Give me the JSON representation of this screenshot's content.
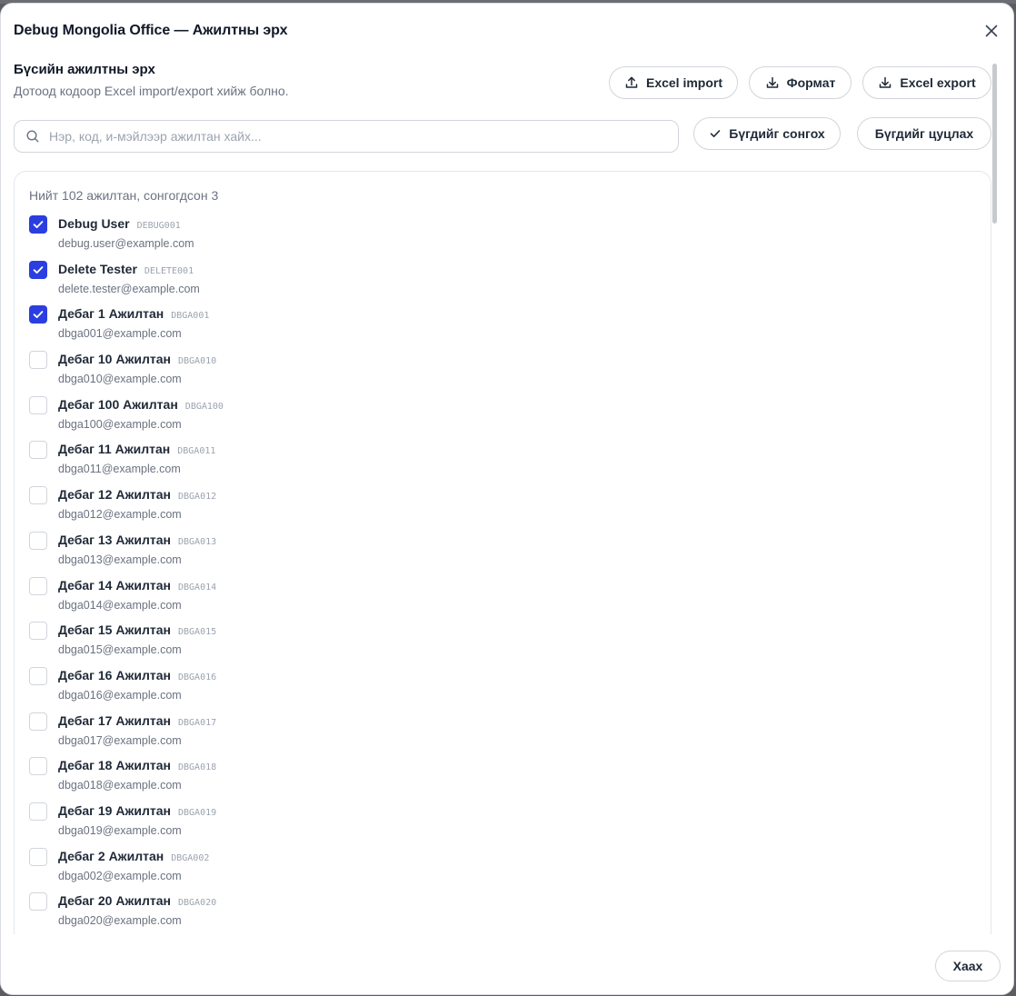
{
  "dialog": {
    "title": "Debug Mongolia Office — Ажилтны эрх"
  },
  "section": {
    "title": "Бүсийн ажилтны эрх",
    "subtitle": "Дотоод кодоор Excel import/export хийж болно."
  },
  "toolbar": {
    "import_label": "Excel import",
    "format_label": "Формат",
    "export_label": "Excel export",
    "select_all_label": "Бүгдийг сонгох",
    "clear_all_label": "Бүгдийг цуцлах"
  },
  "search": {
    "placeholder": "Нэр, код, и-мэйлээр ажилтан хайх...",
    "value": ""
  },
  "list": {
    "summary": "Нийт 102 ажилтан, сонгогдсон 3",
    "employees": [
      {
        "name": "Debug User",
        "code": "DEBUG001",
        "email": "debug.user@example.com",
        "checked": true
      },
      {
        "name": "Delete Tester",
        "code": "DELETE001",
        "email": "delete.tester@example.com",
        "checked": true
      },
      {
        "name": "Дебаг 1 Ажилтан",
        "code": "DBGA001",
        "email": "dbga001@example.com",
        "checked": true
      },
      {
        "name": "Дебаг 10 Ажилтан",
        "code": "DBGA010",
        "email": "dbga010@example.com",
        "checked": false
      },
      {
        "name": "Дебаг 100 Ажилтан",
        "code": "DBGA100",
        "email": "dbga100@example.com",
        "checked": false
      },
      {
        "name": "Дебаг 11 Ажилтан",
        "code": "DBGA011",
        "email": "dbga011@example.com",
        "checked": false
      },
      {
        "name": "Дебаг 12 Ажилтан",
        "code": "DBGA012",
        "email": "dbga012@example.com",
        "checked": false
      },
      {
        "name": "Дебаг 13 Ажилтан",
        "code": "DBGA013",
        "email": "dbga013@example.com",
        "checked": false
      },
      {
        "name": "Дебаг 14 Ажилтан",
        "code": "DBGA014",
        "email": "dbga014@example.com",
        "checked": false
      },
      {
        "name": "Дебаг 15 Ажилтан",
        "code": "DBGA015",
        "email": "dbga015@example.com",
        "checked": false
      },
      {
        "name": "Дебаг 16 Ажилтан",
        "code": "DBGA016",
        "email": "dbga016@example.com",
        "checked": false
      },
      {
        "name": "Дебаг 17 Ажилтан",
        "code": "DBGA017",
        "email": "dbga017@example.com",
        "checked": false
      },
      {
        "name": "Дебаг 18 Ажилтан",
        "code": "DBGA018",
        "email": "dbga018@example.com",
        "checked": false
      },
      {
        "name": "Дебаг 19 Ажилтан",
        "code": "DBGA019",
        "email": "dbga019@example.com",
        "checked": false
      },
      {
        "name": "Дебаг 2 Ажилтан",
        "code": "DBGA002",
        "email": "dbga002@example.com",
        "checked": false
      },
      {
        "name": "Дебаг 20 Ажилтан",
        "code": "DBGA020",
        "email": "dbga020@example.com",
        "checked": false
      }
    ]
  },
  "footer": {
    "close_label": "Хаах"
  },
  "colors": {
    "accent": "#2b3ee0",
    "border": "#d1d5db",
    "muted_text": "#6b7280"
  },
  "icons": {
    "close": "close-icon",
    "upload": "upload-icon",
    "download": "download-icon",
    "search": "search-icon",
    "check": "check-icon"
  }
}
